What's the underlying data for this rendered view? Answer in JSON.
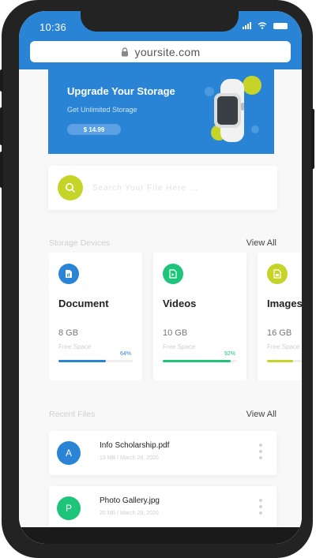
{
  "status_bar": {
    "time": "10:36"
  },
  "browser": {
    "url": "yoursite.com"
  },
  "banner": {
    "title": "Upgrade Your Storage",
    "subtitle": "Get Unlimited Storage",
    "price": "$ 14.99"
  },
  "search": {
    "placeholder": "Search Your File Here ..."
  },
  "storage_section": {
    "title": "Storage Devices",
    "view_all": "View All"
  },
  "storage_cards": [
    {
      "name": "Document",
      "size": "8 GB",
      "free_label": "Free Space",
      "percent_label": "64%",
      "percent": 64,
      "color": "#2a84d5",
      "icon": "document-icon"
    },
    {
      "name": "Videos",
      "size": "10 GB",
      "free_label": "Free Space",
      "percent_label": "92%",
      "percent": 92,
      "color": "#1ec47a",
      "icon": "video-file-icon"
    },
    {
      "name": "Images",
      "size": "16 GB",
      "free_label": "Free Space",
      "percent_label": "",
      "percent": 35,
      "color": "#c6d42a",
      "icon": "image-file-icon"
    }
  ],
  "recent_section": {
    "title": "Recent Files",
    "view_all": "View All"
  },
  "recent_files": [
    {
      "initial": "A",
      "name": "Info Scholarship.pdf",
      "meta": "13 MB / March 28, 2020",
      "color": "#2a84d5"
    },
    {
      "initial": "P",
      "name": "Photo Gallery.jpg",
      "meta": "20 MB / March 28, 2020",
      "color": "#1ec47a"
    }
  ],
  "colors": {
    "primary": "#2a84d5",
    "green": "#1ec47a",
    "lime": "#c6d42a"
  }
}
